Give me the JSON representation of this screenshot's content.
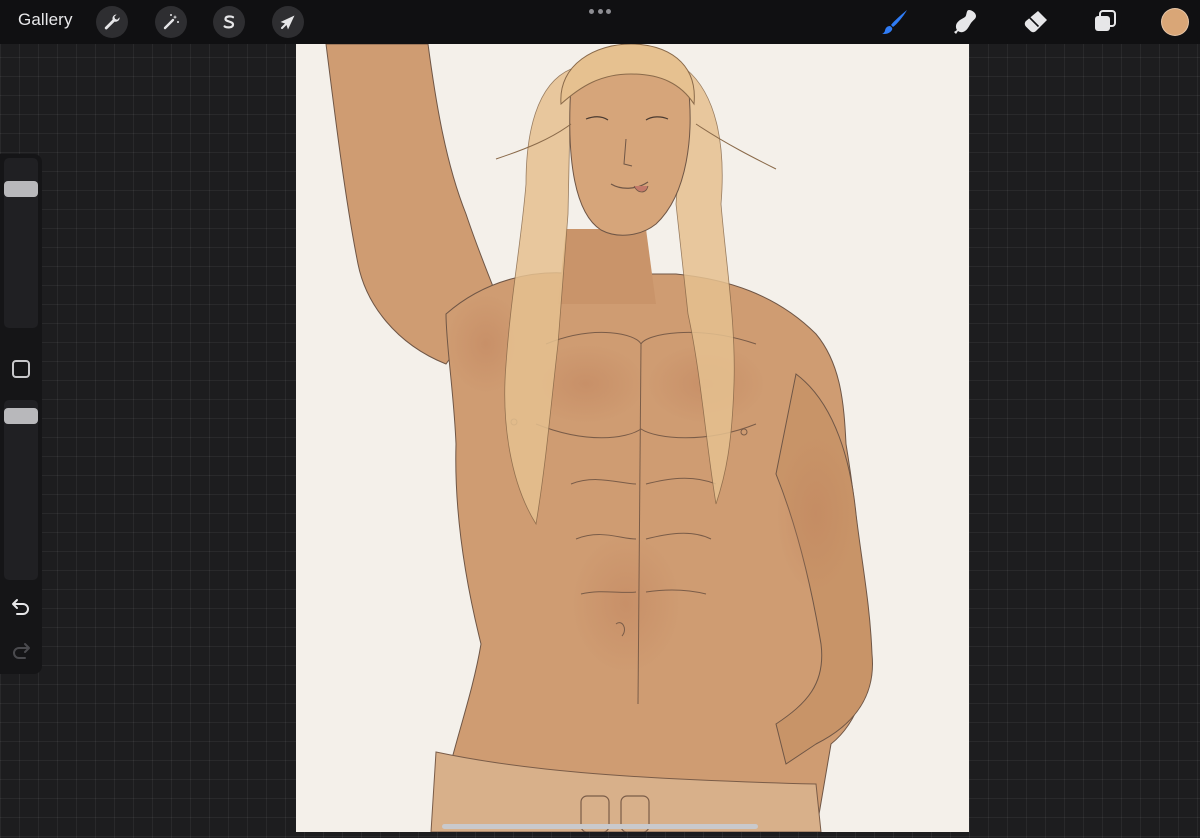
{
  "toolbar": {
    "gallery_label": "Gallery",
    "left_tools": [
      {
        "icon": "wrench-icon",
        "name": "actions"
      },
      {
        "icon": "magic-wand-icon",
        "name": "adjustments"
      },
      {
        "icon": "selection-s-icon",
        "name": "selection"
      },
      {
        "icon": "arrow-cursor-icon",
        "name": "transform"
      }
    ],
    "right_tools": [
      {
        "icon": "brush-icon",
        "name": "paint",
        "active": true
      },
      {
        "icon": "smudge-icon",
        "name": "smudge",
        "active": false
      },
      {
        "icon": "eraser-icon",
        "name": "erase",
        "active": false
      },
      {
        "icon": "layers-icon",
        "name": "layers",
        "active": false
      }
    ],
    "current_color": "#d9a677"
  },
  "sidebar": {
    "brush_size_level": 0.85,
    "brush_opacity_level": 0.95
  },
  "colors": {
    "accent": "#2f7cf6",
    "canvas_background": "#f4f0ea",
    "skin": "#cf9c72",
    "hair": "#e6c190"
  }
}
